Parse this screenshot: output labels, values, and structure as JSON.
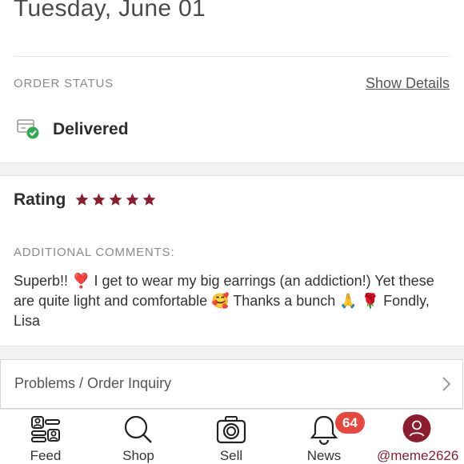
{
  "header": {
    "date": "Tuesday, June 01"
  },
  "order_status": {
    "label": "ORDER STATUS",
    "show_details": "Show Details",
    "status": "Delivered",
    "status_icon": "delivered-box-check-icon",
    "check_color": "#34a853"
  },
  "rating": {
    "label": "Rating",
    "stars": 5,
    "star_color": "#8c1d2e"
  },
  "comments": {
    "label": "ADDITIONAL COMMENTS:",
    "text": "Superb!! ❣️ I get to wear my big earrings (an addiction!) Yet these are quite light and comfortable 🥰 Thanks a bunch 🙏 🌹 Fondly, Lisa"
  },
  "inquiry": {
    "label": "Problems / Order Inquiry"
  },
  "tabbar": {
    "items": [
      {
        "label": "Feed",
        "icon": "feed-icon"
      },
      {
        "label": "Shop",
        "icon": "search-icon"
      },
      {
        "label": "Sell",
        "icon": "camera-icon"
      },
      {
        "label": "News",
        "icon": "bell-icon",
        "badge": "64"
      },
      {
        "label": "@meme2626",
        "icon": "profile-avatar-icon"
      }
    ],
    "badge_color": "#e8473f",
    "brand_color": "#8c1d2e"
  }
}
